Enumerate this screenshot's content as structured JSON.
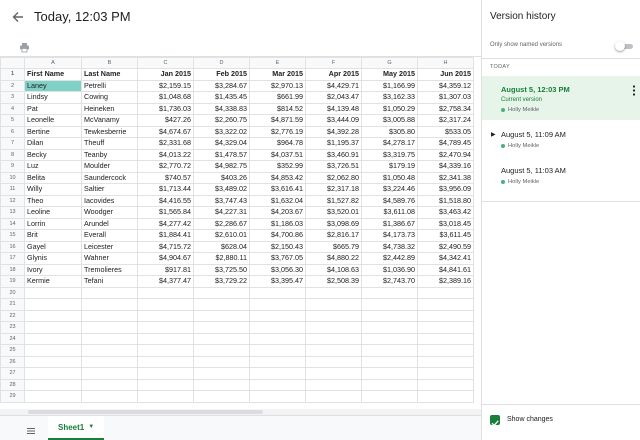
{
  "header": {
    "title": "Today, 12:03 PM"
  },
  "sheet": {
    "columns": [
      "A",
      "B",
      "C",
      "D",
      "E",
      "F",
      "G",
      "H"
    ],
    "rows": [
      [
        "First Name",
        "Last Name",
        "Jan 2015",
        "Feb 2015",
        "Mar 2015",
        "Apr 2015",
        "May 2015",
        "Jun 2015"
      ],
      [
        "Laney",
        "Petrelli",
        "$2,159.15",
        "$3,284.67",
        "$2,970.13",
        "$4,429.71",
        "$1,166.99",
        "$4,359.12"
      ],
      [
        "Lindsy",
        "Cowing",
        "$1,048.68",
        "$1,435.45",
        "$661.99",
        "$2,043.47",
        "$3,162.33",
        "$1,307.03"
      ],
      [
        "Pat",
        "Heineken",
        "$1,736.03",
        "$4,338.83",
        "$814.52",
        "$4,139.48",
        "$1,050.29",
        "$2,758.34"
      ],
      [
        "Leonelle",
        "McVanamy",
        "$427.26",
        "$2,260.75",
        "$4,871.59",
        "$3,444.09",
        "$3,005.88",
        "$2,317.24"
      ],
      [
        "Bertine",
        "Tewkesberrie",
        "$4,674.67",
        "$3,322.02",
        "$2,776.19",
        "$4,392.28",
        "$305.80",
        "$533.05"
      ],
      [
        "Dilan",
        "Theuff",
        "$2,331.68",
        "$4,329.04",
        "$964.78",
        "$1,195.37",
        "$4,278.17",
        "$4,789.45"
      ],
      [
        "Becky",
        "Teanby",
        "$4,013.22",
        "$1,478.57",
        "$4,037.51",
        "$3,460.91",
        "$3,319.75",
        "$2,470.94"
      ],
      [
        "Luz",
        "Moulder",
        "$2,770.72",
        "$4,982.75",
        "$352.99",
        "$3,726.51",
        "$179.19",
        "$4,339.16"
      ],
      [
        "Belita",
        "Saundercock",
        "$740.57",
        "$403.26",
        "$4,853.42",
        "$2,062.80",
        "$1,050.48",
        "$2,341.38"
      ],
      [
        "Willy",
        "Saltier",
        "$1,713.44",
        "$3,489.02",
        "$3,616.41",
        "$2,317.18",
        "$3,224.46",
        "$3,956.09"
      ],
      [
        "Theo",
        "Iacovides",
        "$4,416.55",
        "$3,747.43",
        "$1,632.04",
        "$1,527.82",
        "$4,589.76",
        "$1,518.80"
      ],
      [
        "Leoline",
        "Woodger",
        "$1,565.84",
        "$4,227.31",
        "$4,203.67",
        "$3,520.01",
        "$3,611.08",
        "$3,463.42"
      ],
      [
        "Lorrin",
        "Arundel",
        "$4,277.42",
        "$2,286.67",
        "$1,186.03",
        "$3,098.69",
        "$1,386.67",
        "$3,018.45"
      ],
      [
        "Brit",
        "Everall",
        "$1,884.41",
        "$2,610.01",
        "$4,700.86",
        "$2,816.17",
        "$4,173.73",
        "$3,611.45"
      ],
      [
        "Gayel",
        "Leicester",
        "$4,715.72",
        "$628.04",
        "$2,150.43",
        "$665.79",
        "$4,738.32",
        "$2,490.59"
      ],
      [
        "Glynis",
        "Wahner",
        "$4,904.67",
        "$2,880.11",
        "$3,767.05",
        "$4,880.22",
        "$2,442.89",
        "$4,342.41"
      ],
      [
        "Ivory",
        "Tremolieres",
        "$917.81",
        "$3,725.50",
        "$3,056.30",
        "$4,108.63",
        "$1,036.90",
        "$4,841.61"
      ],
      [
        "Kermie",
        "Tefani",
        "$4,377.47",
        "$3,729.22",
        "$3,395.47",
        "$2,508.39",
        "$2,743.70",
        "$2,389.16"
      ]
    ],
    "total_rows": 29,
    "selected_cell": "A2"
  },
  "tabs": {
    "sheet_name": "Sheet1"
  },
  "panel": {
    "title": "Version history",
    "named_only_label": "Only show named versions",
    "named_only_on": false,
    "section_label": "TODAY",
    "versions": [
      {
        "date": "August 5, 12:03 PM",
        "current_label": "Current version",
        "user": "Holly Meikle"
      },
      {
        "date": "August 5, 11:09 AM",
        "user": "Holly Meikle"
      },
      {
        "date": "August 5, 11:03 AM",
        "user": "Holly Meikle"
      }
    ],
    "show_changes_label": "Show changes",
    "show_changes_checked": true
  },
  "colors": {
    "accent": "#188038",
    "selected_cell": "#7fd1c5",
    "active_version_bg": "#e6f4ea"
  }
}
